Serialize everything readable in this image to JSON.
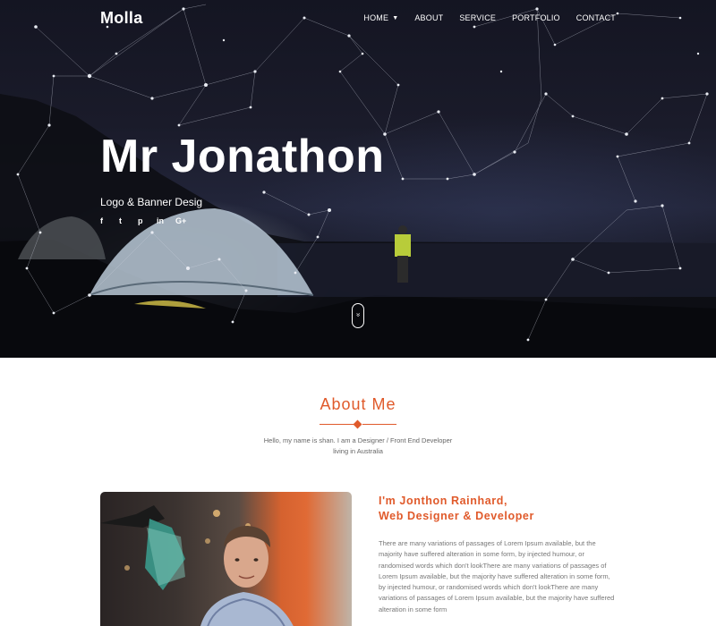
{
  "header": {
    "logo": "Molla",
    "nav": [
      {
        "label": "HOME",
        "has_dropdown": true
      },
      {
        "label": "ABOUT"
      },
      {
        "label": "SERVICE"
      },
      {
        "label": "PORTFOLIO"
      },
      {
        "label": "CONTACT"
      }
    ]
  },
  "hero": {
    "title": "Mr Jonathon",
    "subtitle": "Logo & Banner Desig",
    "socials": [
      {
        "icon": "facebook-icon",
        "glyph": "f"
      },
      {
        "icon": "twitter-icon",
        "glyph": "t"
      },
      {
        "icon": "pinterest-icon",
        "glyph": "p"
      },
      {
        "icon": "linkedin-icon",
        "glyph": "in"
      },
      {
        "icon": "google-plus-icon",
        "glyph": "G+"
      }
    ],
    "scroll_icon": "double-chevron-down-icon",
    "scroll_glyph": "»"
  },
  "about": {
    "title": "About Me",
    "intro_line1": "Hello, my name is shan. I am a Designer / Front End Developer",
    "intro_line2": "living in Australia",
    "name_line1": "I'm Jonthon Rainhard,",
    "name_line2": "Web Designer & Developer",
    "bio": "There are many variations of passages of Lorem Ipsum available, but the majority have suffered alteration in some form, by injected humour, or randomised words which don't lookThere are many variations of passages of Lorem Ipsum available, but the majority have suffered alteration in some form, by injected humour, or randomised words which don't lookThere are many variations of passages of Lorem Ipsum available, but the majority have suffered alteration in some form"
  },
  "colors": {
    "accent": "#e05a2b",
    "hero_bg": "#1a1b2a",
    "text_muted": "#777777"
  }
}
